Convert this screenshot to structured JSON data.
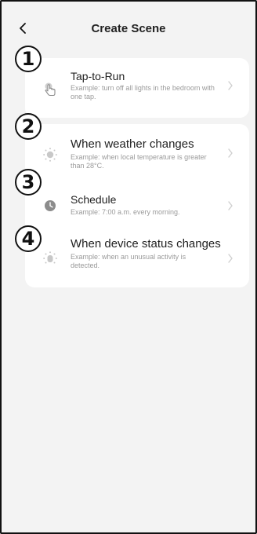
{
  "header": {
    "title": "Create Scene",
    "back_icon": "chevron-left-icon"
  },
  "colors": {
    "background": "#f3f3f3",
    "card": "#ffffff",
    "icon_gray": "#b5b5b5",
    "icon_dark": "#8c8c8c"
  },
  "steps": [
    "1",
    "2",
    "3",
    "4"
  ],
  "options": [
    {
      "title": "Tap-to-Run",
      "description": "Example: turn off all lights in the bedroom with one tap.",
      "icon": "hand-tap-icon"
    },
    {
      "title": "When weather changes",
      "description": "Example: when local temperature is greater than 28°C.",
      "icon": "sun-icon"
    },
    {
      "title": "Schedule",
      "description": "Example: 7:00 a.m. every morning.",
      "icon": "clock-icon"
    },
    {
      "title": "When device status changes",
      "description": "Example: when an unusual activity is detected.",
      "icon": "device-status-icon"
    }
  ]
}
